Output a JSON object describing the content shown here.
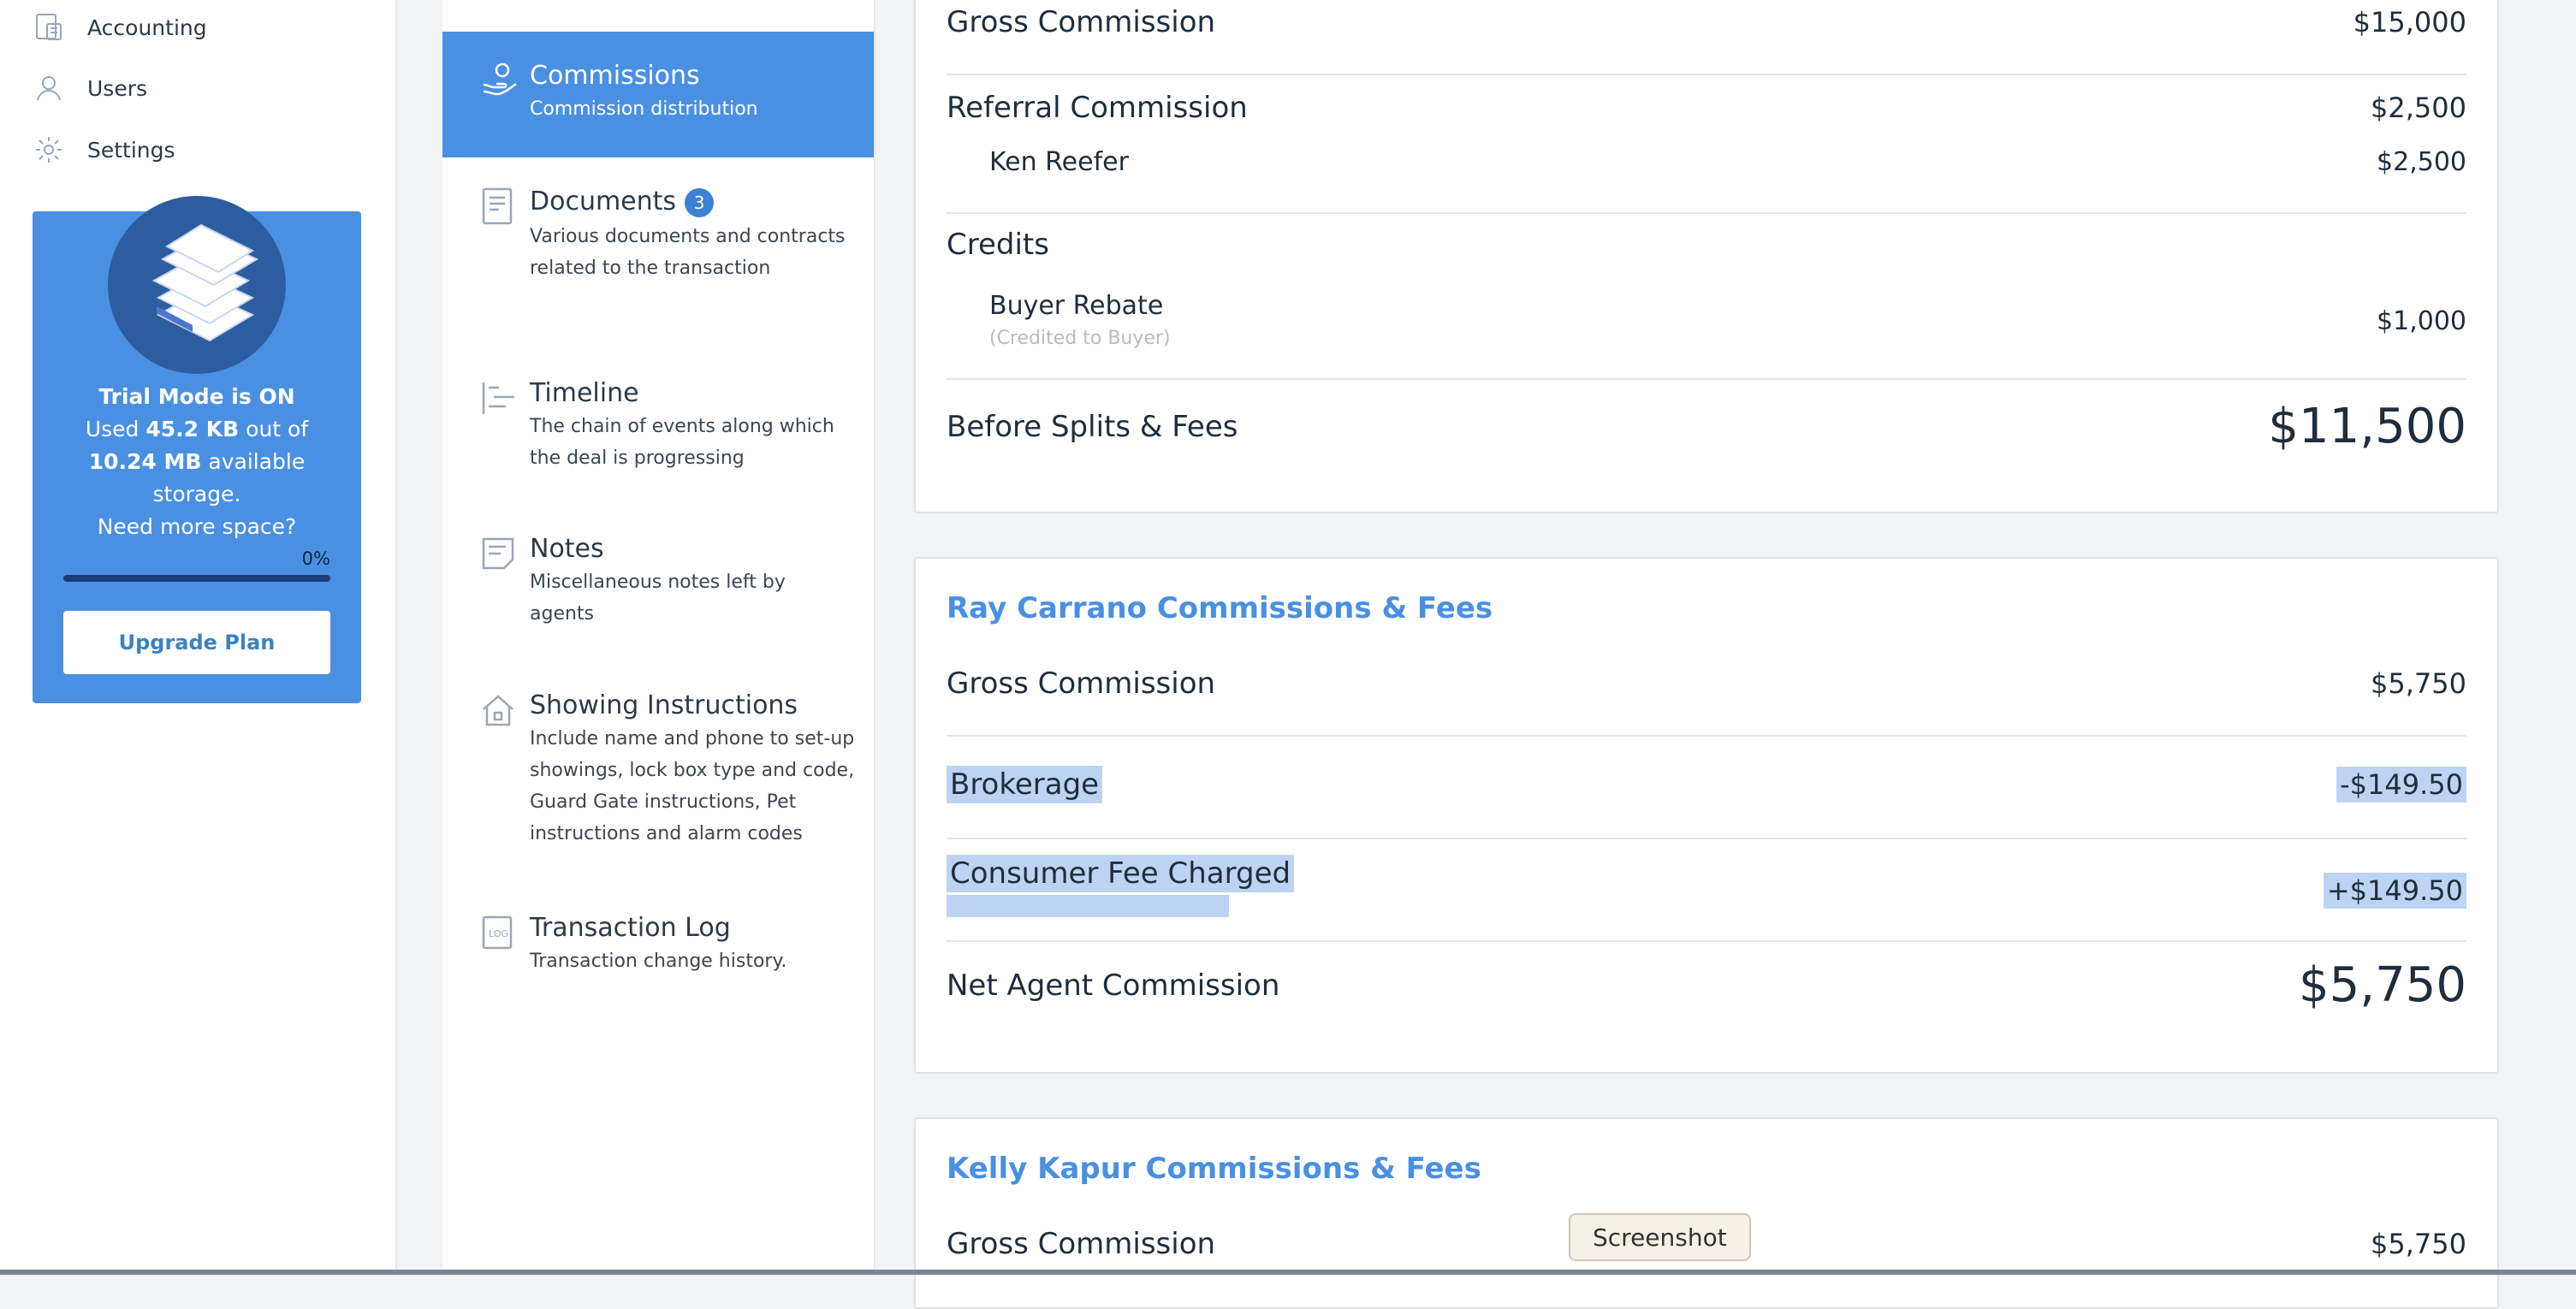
{
  "nav": {
    "items": [
      {
        "label": "Accounting",
        "icon": "accounting-icon"
      },
      {
        "label": "Users",
        "icon": "user-icon"
      },
      {
        "label": "Settings",
        "icon": "gear-icon"
      }
    ]
  },
  "trial": {
    "line1": "Trial Mode is ON",
    "used_prefix": "Used",
    "used_value": "45.2 KB",
    "used_mid": "out of",
    "avail_value": "10.24 MB",
    "avail_suffix": "available",
    "storage": "storage.",
    "need_more": "Need more space?",
    "progress_pct": "0%",
    "progress_value": 0,
    "upgrade_label": "Upgrade Plan"
  },
  "tabs": [
    {
      "title": "Commissions",
      "desc": "Commission distribution",
      "icon": "hand-coin-icon",
      "active": true
    },
    {
      "title": "Documents",
      "desc": "Various documents and contracts related to the transaction",
      "count": "3",
      "icon": "document-icon"
    },
    {
      "title": "Timeline",
      "desc": "The chain of events along which the deal is progressing",
      "icon": "timeline-icon"
    },
    {
      "title": "Notes",
      "desc": "Miscellaneous notes left by agents",
      "icon": "note-icon"
    },
    {
      "title": "Showing Instructions",
      "desc": "Include name and phone to set-up showings, lock box type and code, Guard Gate instructions, Pet instructions and alarm codes",
      "icon": "house-icon"
    },
    {
      "title": "Transaction Log",
      "desc": "Transaction change history.",
      "icon": "log-icon"
    }
  ],
  "summary": {
    "gross_label": "Gross Commission",
    "gross_value": "$15,000",
    "referral_label": "Referral Commission",
    "referral_value": "$2,500",
    "referral_agent": "Ken Reefer",
    "referral_agent_value": "$2,500",
    "credits_label": "Credits",
    "rebate_label": "Buyer Rebate",
    "rebate_note": "(Credited to Buyer)",
    "rebate_value": "$1,000",
    "before_label": "Before Splits & Fees",
    "before_value": "$11,500"
  },
  "ray": {
    "title": "Ray Carrano Commissions & Fees",
    "gross_label": "Gross Commission",
    "gross_value": "$5,750",
    "brokerage_label": "Brokerage",
    "brokerage_value": "-$149.50",
    "consumer_label": "Consumer Fee Charged",
    "consumer_value": "+$149.50",
    "net_label": "Net Agent Commission",
    "net_value": "$5,750"
  },
  "kelly": {
    "title": "Kelly Kapur Commissions & Fees",
    "gross_label": "Gross Commission",
    "gross_value": "$5,750"
  },
  "tooltip": "Screenshot",
  "colors": {
    "accent": "#4a90e2",
    "highlight": "#bcd4f2"
  }
}
